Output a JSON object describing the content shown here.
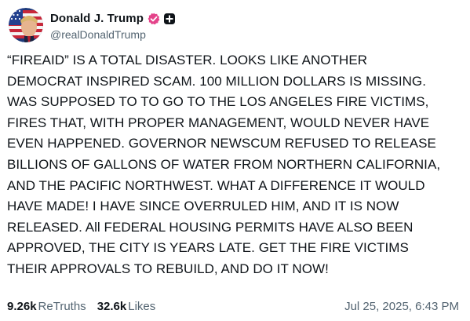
{
  "author": {
    "display_name": "Donald J. Trump",
    "handle": "@realDonaldTrump",
    "verified_color": "#e4438a",
    "avatar_icon": "flag-avatar"
  },
  "post": {
    "text": "“FIREAID” IS A TOTAL DISASTER. LOOKS LIKE ANOTHER\nDEMOCRAT INSPIRED SCAM. 100 MILLION DOLLARS IS MISSING.\nWAS SUPPOSED TO TO GO TO THE LOS ANGELES FIRE VICTIMS,\nFIRES THAT, WITH PROPER MANAGEMENT, WOULD NEVER HAVE\nEVEN HAPPENED. GOVERNOR NEWSCUM REFUSED TO RELEASE\nBILLIONS OF GALLONS OF WATER FROM NORTHERN CALIFORNIA,\nAND THE PACIFIC NORTHWEST. WHAT A DIFFERENCE IT WOULD\nHAVE MADE! I HAVE SINCE OVERRULED HIM, AND IT IS NOW\nRELEASED. All FEDERAL HOUSING PERMITS HAVE ALSO BEEN\nAPPROVED, THE CITY IS YEARS LATE. GET THE FIRE VICTIMS\nTHEIR APPROVALS TO REBUILD, AND DO IT NOW!"
  },
  "stats": {
    "retruths_count": "9.26k",
    "retruths_label": "ReTruths",
    "likes_count": "32.6k",
    "likes_label": "Likes"
  },
  "timestamp": "Jul 25, 2025, 6:43 PM"
}
